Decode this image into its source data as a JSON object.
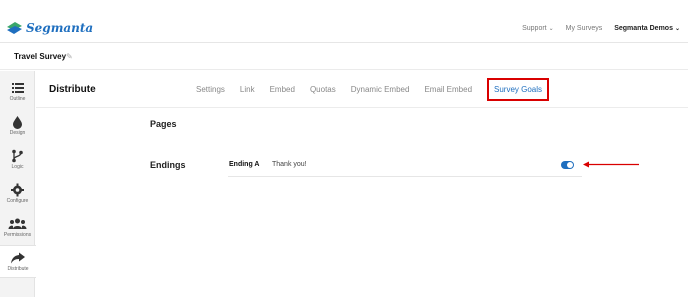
{
  "brand": {
    "name": "Segmanta"
  },
  "topnav": {
    "support": "Support",
    "my_surveys": "My Surveys",
    "account": "Segmanta Demos"
  },
  "survey": {
    "title": "Travel Survey"
  },
  "sidebar": {
    "items": [
      {
        "label": "Outline",
        "icon": "list-icon"
      },
      {
        "label": "Design",
        "icon": "droplet-icon"
      },
      {
        "label": "Logic",
        "icon": "branch-icon"
      },
      {
        "label": "Configure",
        "icon": "gear-icon"
      },
      {
        "label": "Permissions",
        "icon": "people-icon"
      },
      {
        "label": "Distribute",
        "icon": "share-arrow-icon",
        "active": true
      }
    ]
  },
  "main": {
    "title": "Distribute",
    "tabs": [
      "Settings",
      "Link",
      "Embed",
      "Quotas",
      "Dynamic Embed",
      "Email Embed",
      "Survey Goals"
    ],
    "active_tab": "Survey Goals",
    "pages_label": "Pages",
    "endings_label": "Endings",
    "endings": [
      {
        "name": "Ending A",
        "message": "Thank you!",
        "enabled": true
      }
    ]
  },
  "colors": {
    "accent": "#1f6fbf",
    "highlight": "#d90000",
    "logo_green": "#3aa66b"
  }
}
